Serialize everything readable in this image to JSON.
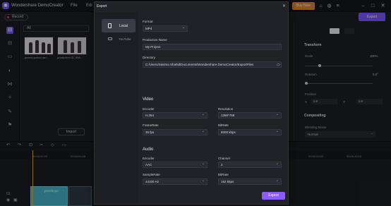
{
  "app": {
    "title": "Wondershare DemoCreator",
    "menu": [
      "File",
      "Edi"
    ],
    "buy_now": "Buy Now",
    "export_button": "Export"
  },
  "media": {
    "record_label": "Record",
    "filter": "All",
    "thumbs": [
      {
        "caption": "pexels-polina-tan..."
      },
      {
        "caption": "production ID_558..."
      }
    ],
    "import_label": "Import"
  },
  "properties": {
    "transform": "Transform",
    "scale_label": "Scale",
    "scale_value": "100%",
    "rotation_label": "Rotation",
    "rotation_value": "0.0°",
    "position_label": "Position",
    "pos_x_label": "X",
    "pos_x_value": "0.0",
    "pos_y_label": "Y",
    "pos_y_value": "0.0",
    "compositing": "Compositing",
    "blend_label": "Blending Mode",
    "blend_value": "Normal"
  },
  "timeline": {
    "ruler": [
      "00:00:00:00",
      "00:00:04:05",
      "00:00:29:05",
      "00:00:33:10"
    ],
    "clip1_label": "pexels-po",
    "track_number": "01"
  },
  "dialog": {
    "title": "Export",
    "close": "✕",
    "tabs": [
      {
        "label": "Local"
      },
      {
        "label": "YouTube"
      }
    ],
    "format_label": "Format",
    "format_value": "MP4",
    "name_label": "Production Name",
    "name_value": "My Project",
    "dir_label": "Directory",
    "dir_value": "C:/Users/Sasima Shahid/Documents/Wondershare DemoCreator/ExportFiles",
    "video_title": "Video",
    "v_encoder_label": "Encoder",
    "v_encoder_value": "H.264",
    "resolution_label": "Resolution",
    "resolution_value": "1366*768",
    "framerate_label": "FrameRate",
    "framerate_value": "30 fps",
    "v_bitrate_label": "BitRate",
    "v_bitrate_value": "8000 kbps",
    "audio_title": "Audio",
    "a_encoder_label": "Encoder",
    "a_encoder_value": "AAC",
    "channel_label": "Channel",
    "channel_value": "2",
    "samplerate_label": "SampleRate",
    "samplerate_value": "44100 Hz",
    "a_bitrate_label": "BitRate",
    "a_bitrate_value": "192 kbps",
    "export_label": "Export"
  }
}
